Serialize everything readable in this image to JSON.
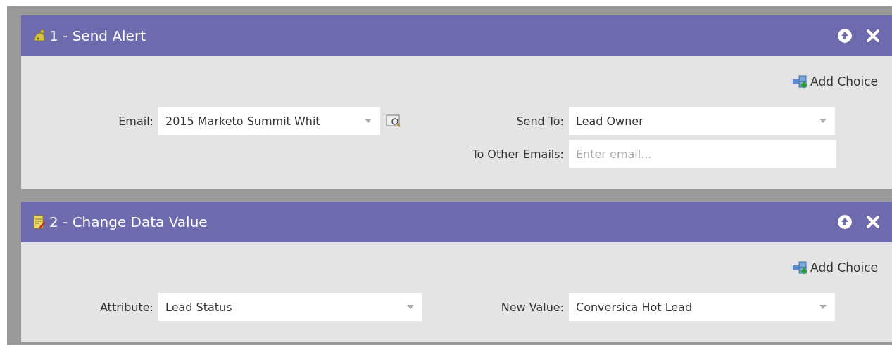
{
  "steps": [
    {
      "title": "1 - Send Alert",
      "kind": "send_alert",
      "add_choice": "Add Choice",
      "left": [
        {
          "label": "Email:",
          "kind": "select_preview",
          "value": "2015 Marketo Summit Whit"
        }
      ],
      "right": [
        {
          "label": "Send To:",
          "kind": "select",
          "value": "Lead Owner"
        },
        {
          "label": "To Other Emails:",
          "kind": "input",
          "placeholder": "Enter email..."
        }
      ]
    },
    {
      "title": "2 - Change Data Value",
      "kind": "change_data_value",
      "add_choice": "Add Choice",
      "left": [
        {
          "label": "Attribute:",
          "kind": "select",
          "value": "Lead Status"
        }
      ],
      "right": [
        {
          "label": "New Value:",
          "kind": "select",
          "value": "Conversica Hot Lead"
        }
      ]
    }
  ]
}
